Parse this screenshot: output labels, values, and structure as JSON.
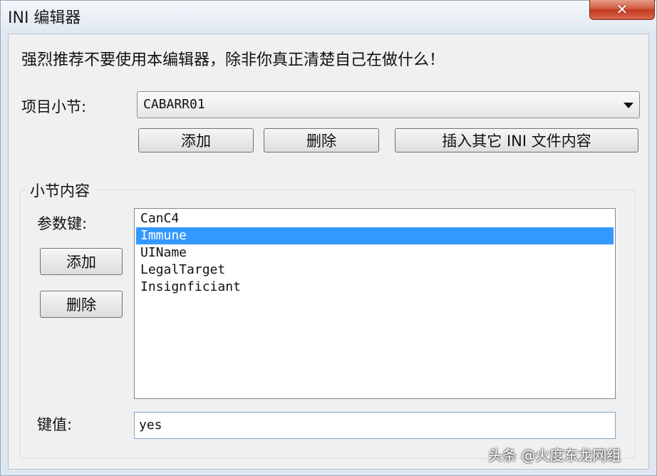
{
  "window": {
    "title": "INI 编辑器",
    "close_glyph": "✕"
  },
  "warning": "强烈推荐不要使用本编辑器，除非你真正清楚自己在做什么！",
  "section": {
    "label": "项目小节:",
    "selected": "CABARR01",
    "buttons": {
      "add": "添加",
      "delete": "删除",
      "insert": "插入其它 INI 文件内容"
    }
  },
  "content_group": {
    "title": "小节内容",
    "key_label": "参数键:",
    "add": "添加",
    "delete": "删除",
    "keys": [
      "CanC4",
      "Immune",
      "UIName",
      "LegalTarget",
      "Insignficiant"
    ],
    "selected_index": 1,
    "value_label": "键值:",
    "value": "yes"
  },
  "watermark": "头条 @火度东龙网组",
  "colors": {
    "selection": "#3399ff",
    "close_button": "#c33b21"
  }
}
